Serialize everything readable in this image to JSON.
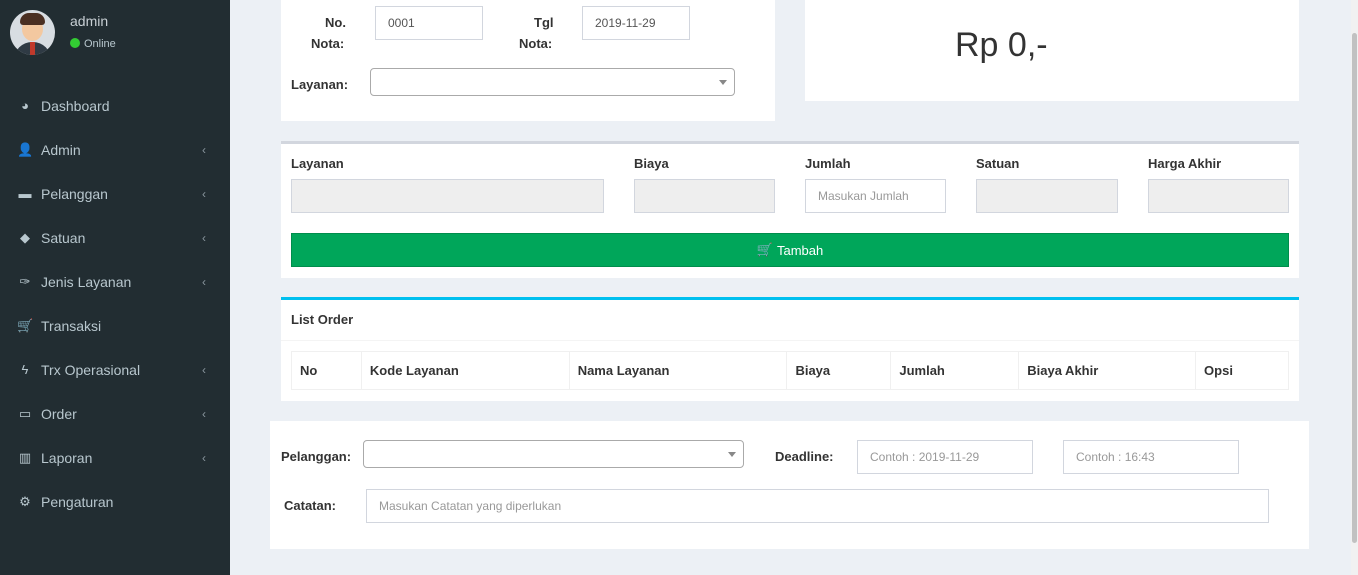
{
  "user": {
    "name": "admin",
    "status": "Online"
  },
  "menu": [
    {
      "label": "Dashboard",
      "icon": "dashboard-icon",
      "glyph": "◕",
      "has_children": false
    },
    {
      "label": "Admin",
      "icon": "user-icon",
      "glyph": "👤",
      "has_children": true
    },
    {
      "label": "Pelanggan",
      "icon": "folder-icon",
      "glyph": "▬",
      "has_children": true
    },
    {
      "label": "Satuan",
      "icon": "tag-icon",
      "glyph": "◆",
      "has_children": true
    },
    {
      "label": "Jenis Layanan",
      "icon": "thumbtack-icon",
      "glyph": "✑",
      "has_children": true
    },
    {
      "label": "Transaksi",
      "icon": "cart-icon",
      "glyph": "🛒",
      "has_children": false
    },
    {
      "label": "Trx Operasional",
      "icon": "bolt-icon",
      "glyph": "ϟ",
      "has_children": true
    },
    {
      "label": "Order",
      "icon": "inbox-icon",
      "glyph": "▭",
      "has_children": true
    },
    {
      "label": "Laporan",
      "icon": "bar-chart-icon",
      "glyph": "▥",
      "has_children": true
    },
    {
      "label": "Pengaturan",
      "icon": "gear-icon",
      "glyph": "⚙",
      "has_children": false
    }
  ],
  "nota": {
    "no_label_1": "No.",
    "no_label_2": "Nota:",
    "no_value": "0001",
    "tgl_label_1": "Tgl",
    "tgl_label_2": "Nota:",
    "tgl_value": "2019-11-29",
    "layanan_label": "Layanan:",
    "layanan_value": ""
  },
  "total": "Rp 0,-",
  "item_form": {
    "layanan_label": "Layanan",
    "biaya_label": "Biaya",
    "jumlah_label": "Jumlah",
    "jumlah_placeholder": "Masukan Jumlah",
    "satuan_label": "Satuan",
    "harga_akhir_label": "Harga Akhir",
    "add_button": "Tambah"
  },
  "list_order": {
    "title": "List Order",
    "columns": [
      "No",
      "Kode Layanan",
      "Nama Layanan",
      "Biaya",
      "Jumlah",
      "Biaya Akhir",
      "Opsi"
    ]
  },
  "customer_form": {
    "pelanggan_label": "Pelanggan:",
    "deadline_label": "Deadline:",
    "deadline_date_placeholder": "Contoh : 2019-11-29",
    "deadline_time_placeholder": "Contoh : 16:43",
    "catatan_label": "Catatan:",
    "catatan_placeholder": "Masukan Catatan yang diperlukan"
  },
  "colors": {
    "sidebar": "#222d32",
    "success": "#00a65a",
    "info": "#00c0ef"
  }
}
